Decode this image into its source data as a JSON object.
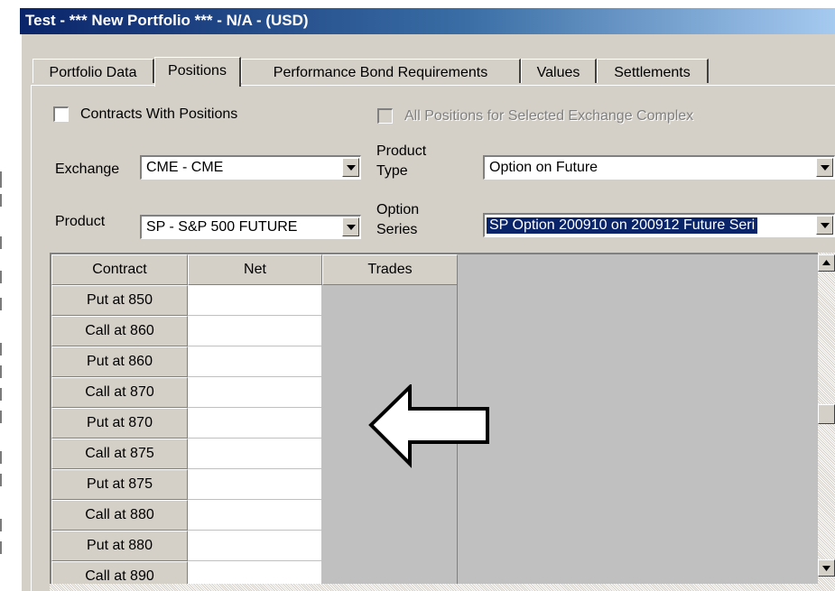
{
  "window": {
    "title": "Test - *** New Portfolio *** - N/A - (USD)"
  },
  "tabs": [
    {
      "label": "Portfolio Data"
    },
    {
      "label": "Positions"
    },
    {
      "label": "Performance Bond Requirements"
    },
    {
      "label": "Values"
    },
    {
      "label": "Settlements"
    }
  ],
  "filters": {
    "contracts_with_positions": {
      "label": "Contracts With Positions",
      "checked": false
    },
    "all_positions": {
      "label": "All Positions for Selected Exchange Complex",
      "checked": false,
      "enabled": false
    },
    "exchange": {
      "label": "Exchange",
      "value": "CME - CME"
    },
    "product_type": {
      "label_line1": "Product",
      "label_line2": "Type",
      "value": "Option on Future"
    },
    "product": {
      "label": "Product",
      "value": "SP -  S&P 500 FUTURE"
    },
    "option_series": {
      "label_line1": "Option",
      "label_line2": "Series",
      "value": "SP Option 200910 on 200912 Future Seri"
    }
  },
  "grid": {
    "columns": [
      "Contract",
      "Net",
      "Trades"
    ],
    "rows": [
      "Put at 850",
      "Call at 860",
      "Put at 860",
      "Call at 870",
      "Put at 870",
      "Call at 875",
      "Put at 875",
      "Call at 880",
      "Put at 880",
      "Call at 890"
    ]
  },
  "colors": {
    "titlebar": "#0a246a",
    "face": "#d4d0c8",
    "selection": "#0a246a"
  },
  "icons": [
    "arrow-left-annotation-icon",
    "scroll-up-icon",
    "scroll-down-icon",
    "dropdown-arrow-icon",
    "checkbox-icon"
  ]
}
